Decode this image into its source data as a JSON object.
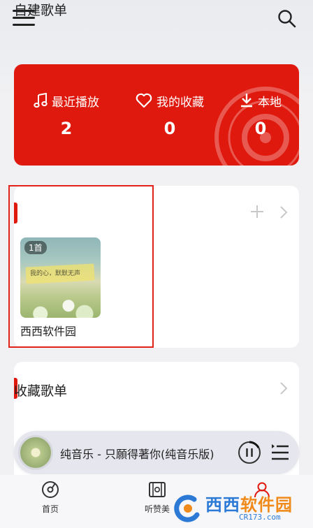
{
  "topbar": {
    "menu_icon": "hamburger-menu-icon",
    "search_icon": "search-icon"
  },
  "stats": {
    "recent": {
      "label": "最近播放",
      "count": "2",
      "icon": "music-note-icon"
    },
    "favorites": {
      "label": "我的收藏",
      "count": "0",
      "icon": "heart-icon"
    },
    "local": {
      "label": "本地",
      "count": "0",
      "icon": "download-icon"
    }
  },
  "self_playlists": {
    "title": "自建歌单",
    "items": [
      {
        "name": "西西软件园",
        "badge": "1首",
        "cover_caption": "我的心，默默无声"
      }
    ]
  },
  "fav_playlists": {
    "title": "收藏歌单"
  },
  "player": {
    "title": "纯音乐 - 只願得著你(纯音乐版)"
  },
  "nav": {
    "home": {
      "label": "首页",
      "icon": "disc-icon"
    },
    "listen": {
      "label": "听赞美",
      "icon": "film-icon"
    },
    "me": {
      "label": "",
      "icon": "user-icon"
    }
  },
  "watermark": {
    "main_a": "西西",
    "main_b": "软件园",
    "sub": "CR173.com"
  },
  "colors": {
    "accent": "#e0190e",
    "highlight": "#e2231a"
  }
}
